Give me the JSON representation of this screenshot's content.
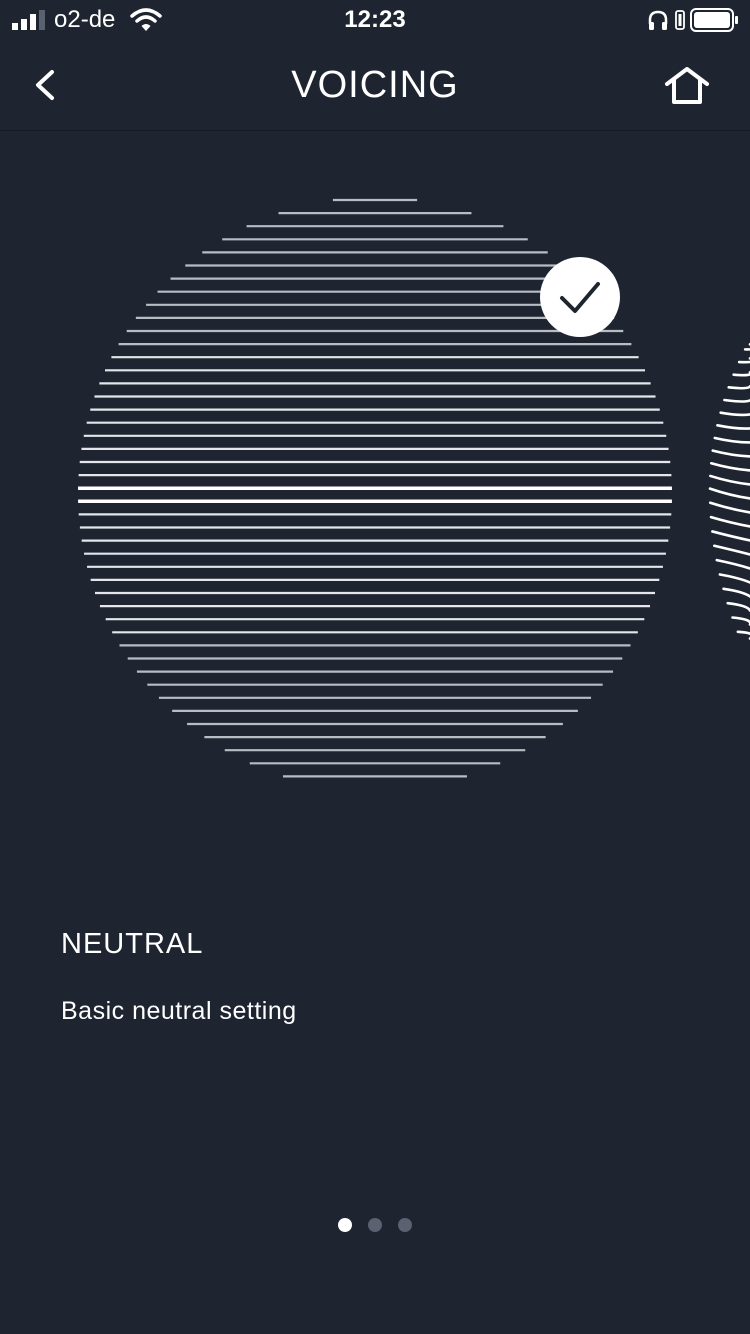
{
  "status_bar": {
    "carrier": "o2-de",
    "time": "12:23",
    "icons": [
      "signal-icon",
      "wifi-icon",
      "headphones-icon",
      "orientation-lock-icon",
      "battery-icon"
    ]
  },
  "nav": {
    "title": "VOICING",
    "back_icon": "chevron-left-icon",
    "home_icon": "home-icon"
  },
  "voicing": {
    "selected_name": "NEUTRAL",
    "selected_description": "Basic neutral setting",
    "selected_check_icon": "check-icon"
  },
  "pagination": {
    "total_pages": 3,
    "current_page": 1
  },
  "colors": {
    "background": "#1f2530",
    "foreground": "#ffffff",
    "inactive_dot": "#5a6170"
  }
}
